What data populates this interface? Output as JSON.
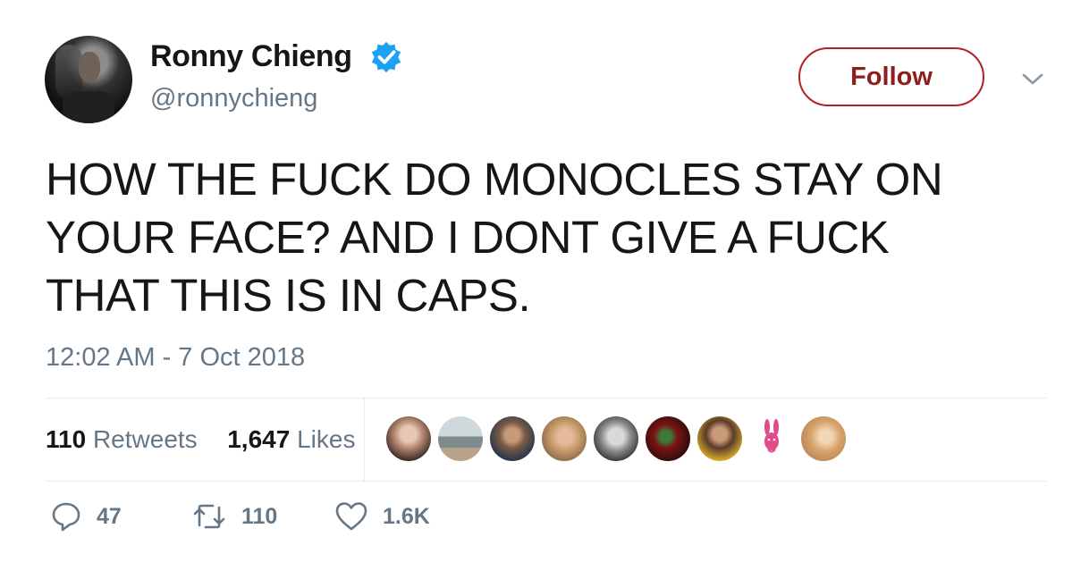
{
  "user": {
    "name": "Ronny Chieng",
    "handle": "@ronnychieng",
    "verified": true
  },
  "follow_button": {
    "label": "Follow"
  },
  "tweet": {
    "lines": [
      "HOW THE FUCK DO MONOCLES STAY ON",
      "YOUR FACE? AND I DONT GIVE A FUCK",
      "THAT THIS IS IN CAPS."
    ],
    "timestamp": "12:02 AM - 7 Oct 2018"
  },
  "stats": {
    "retweets_count": "110",
    "retweets_label": "Retweets",
    "likes_count": "1,647",
    "likes_label": "Likes"
  },
  "likers": [
    {
      "icon": "liker-avatar-1"
    },
    {
      "icon": "liker-avatar-2"
    },
    {
      "icon": "liker-avatar-3"
    },
    {
      "icon": "liker-avatar-4"
    },
    {
      "icon": "liker-avatar-5"
    },
    {
      "icon": "liker-avatar-6"
    },
    {
      "icon": "liker-avatar-7"
    },
    {
      "icon": "liker-avatar-8"
    },
    {
      "icon": "liker-avatar-9"
    }
  ],
  "actions": {
    "replies": "47",
    "retweets": "110",
    "likes": "1.6K"
  },
  "colors": {
    "verified_blue": "#1da1f2",
    "follow_red": "#8f1d1d",
    "secondary_text": "#657786"
  }
}
